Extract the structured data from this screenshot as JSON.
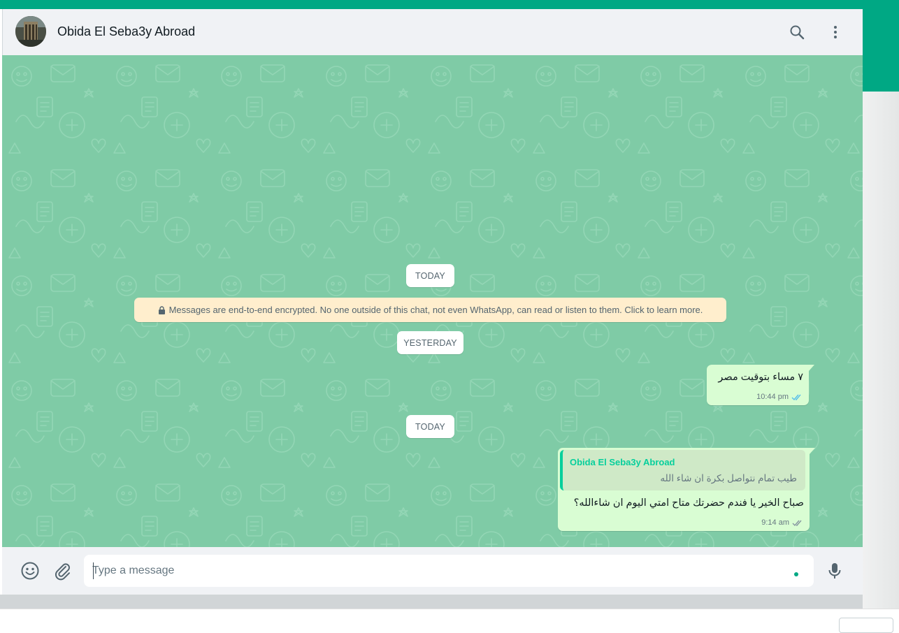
{
  "colors": {
    "accent": "#00a884",
    "chat_bg": "#7fcba6",
    "outgoing_bubble": "#d9fdd3",
    "encryption_banner": "#ffeecd",
    "read_ticks": "#53bdeb",
    "quote_author": "#06cf9c"
  },
  "header": {
    "contact_name": "Obida El Seba3y Abroad",
    "icons": [
      "search-icon",
      "menu-icon"
    ]
  },
  "chat": {
    "date_today_1": "TODAY",
    "encryption_notice": "Messages are end-to-end encrypted. No one outside of this chat, not even WhatsApp, can read or listen to them. Click to learn more.",
    "date_yesterday": "YESTERDAY",
    "messages": [
      {
        "text": "٧ مساء بتوقيت مصر",
        "time": "10:44 pm",
        "status": "read"
      },
      {
        "quote": {
          "author": "Obida El Seba3y Abroad",
          "text": "طيب تمام نتواصل بكرة ان شاء الله"
        },
        "text": "صباح الخير يا فندم حضرتك متاح امتي اليوم ان شاءالله؟",
        "time": "9:14 am",
        "status": "read"
      }
    ],
    "date_today_2": "TODAY"
  },
  "footer": {
    "placeholder": "Type a message",
    "icons": [
      "emoji-icon",
      "attach-icon",
      "mic-icon"
    ]
  }
}
